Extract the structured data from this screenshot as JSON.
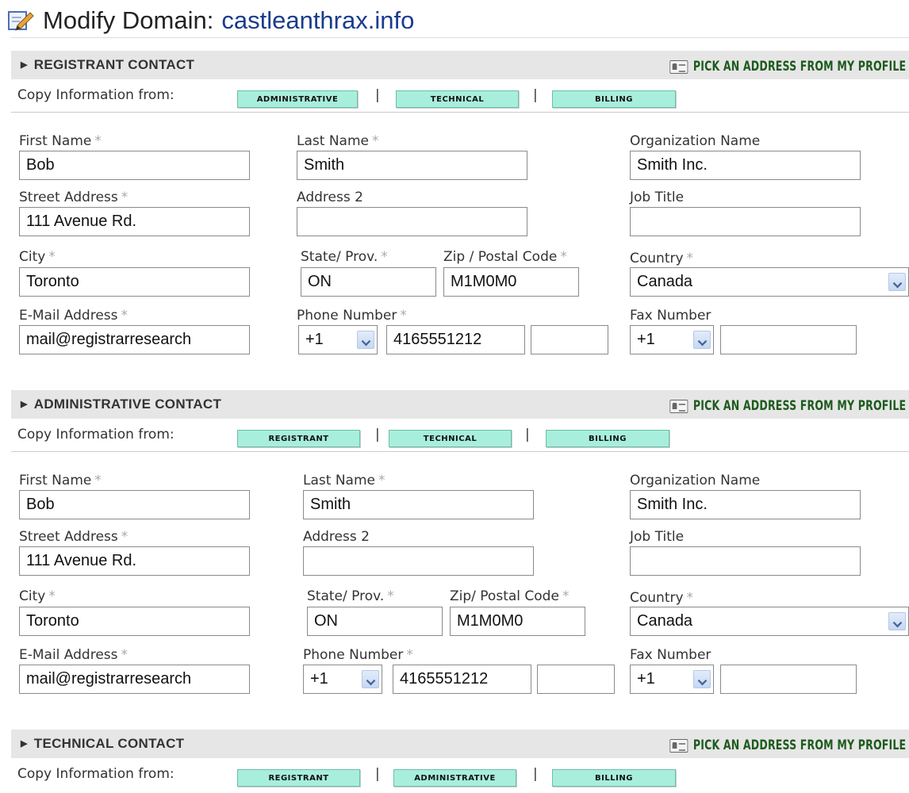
{
  "page": {
    "title": "Modify Domain:",
    "domain": "castleanthrax.info"
  },
  "sections": [
    {
      "title": "REGISTRANT CONTACT",
      "pick": "PICK AN ADDRESS FROM MY PROFILE",
      "copy_label": "Copy Information from:",
      "copy_buttons": [
        "ADMINISTRATIVE",
        "TECHNICAL",
        "BILLING"
      ],
      "labels": {
        "first": "First Name",
        "last": "Last Name",
        "org": "Organization Name",
        "street": "Street Address",
        "addr2": "Address 2",
        "job": "Job Title",
        "city": "City",
        "state": "State/ Prov.",
        "zip": "Zip / Postal Code",
        "country": "Country",
        "email": "E-Mail Address",
        "phone": "Phone Number",
        "fax": "Fax Number",
        "req": "*"
      },
      "values": {
        "first": "Bob",
        "last": "Smith",
        "org": "Smith Inc.",
        "street": "111 Avenue Rd.",
        "addr2": "",
        "job": "",
        "city": "Toronto",
        "state": "ON",
        "zip": "M1M0M0",
        "country": "Canada",
        "email": "mail@registrarresearch",
        "phone_cc": "+1",
        "phone": "4165551212",
        "phone_ext": "",
        "fax_cc": "+1",
        "fax": ""
      }
    },
    {
      "title": "ADMINISTRATIVE CONTACT",
      "pick": "PICK AN ADDRESS FROM MY PROFILE",
      "copy_label": "Copy Information from:",
      "copy_buttons": [
        "REGISTRANT",
        "TECHNICAL",
        "BILLING"
      ],
      "labels": {
        "first": "First Name",
        "last": "Last Name",
        "org": "Organization Name",
        "street": "Street Address",
        "addr2": "Address 2",
        "job": "Job Title",
        "city": "City",
        "state": "State/ Prov.",
        "zip": "Zip/ Postal Code",
        "country": "Country",
        "email": "E-Mail Address",
        "phone": "Phone Number",
        "fax": "Fax Number",
        "req": "*"
      },
      "values": {
        "first": "Bob",
        "last": "Smith",
        "org": "Smith Inc.",
        "street": "111 Avenue Rd.",
        "addr2": "",
        "job": "",
        "city": "Toronto",
        "state": "ON",
        "zip": "M1M0M0",
        "country": "Canada",
        "email": "mail@registrarresearch",
        "phone_cc": "+1",
        "phone": "4165551212",
        "phone_ext": "",
        "fax_cc": "+1",
        "fax": ""
      }
    },
    {
      "title": "TECHNICAL CONTACT",
      "pick": "PICK AN ADDRESS FROM MY PROFILE",
      "copy_label": "Copy Information from:",
      "copy_buttons": [
        "REGISTRANT",
        "ADMINISTRATIVE",
        "BILLING"
      ],
      "separator": "|"
    }
  ],
  "colors": {
    "domain": "#1a3c8f",
    "pick_link": "#1d5b1d",
    "copy_button": "#a8eedd",
    "header_bg": "#e6e6e6"
  }
}
